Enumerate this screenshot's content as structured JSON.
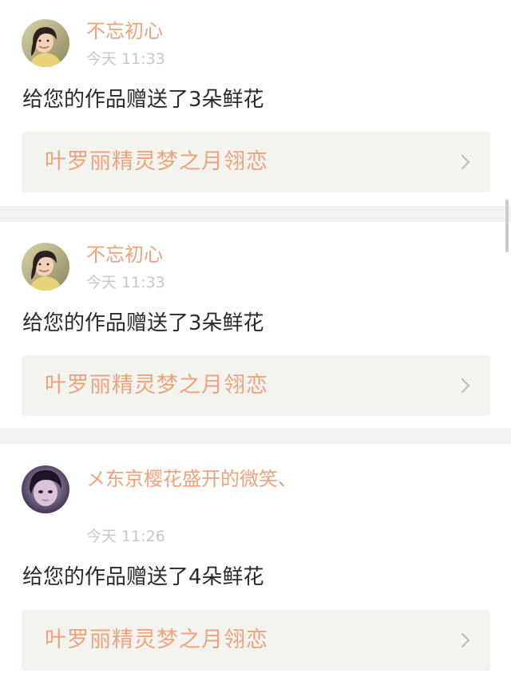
{
  "colors": {
    "accent": "#f0a27a",
    "link_bg": "#f3f3ef",
    "separator": "#f3f2f0",
    "time": "#c7c7c7",
    "text": "#2a2a2a"
  },
  "items": [
    {
      "avatar": "avatar-photo-woman-smiling",
      "username": "不忘初心",
      "time": "今天 11:33",
      "message": "给您的作品赠送了3朵鲜花",
      "work_title": "叶罗丽精灵梦之月翎恋",
      "chevron": "chevron-right-icon"
    },
    {
      "avatar": "avatar-photo-woman-smiling",
      "username": "不忘初心",
      "time": "今天 11:33",
      "message": "给您的作品赠送了3朵鲜花",
      "work_title": "叶罗丽精灵梦之月翎恋",
      "chevron": "chevron-right-icon"
    },
    {
      "avatar": "avatar-photo-girl-purple",
      "username": "メ东京樱花盛开的微笑、",
      "time": "今天 11:26",
      "message": "给您的作品赠送了4朵鲜花",
      "work_title": "叶罗丽精灵梦之月翎恋",
      "chevron": "chevron-right-icon"
    }
  ]
}
